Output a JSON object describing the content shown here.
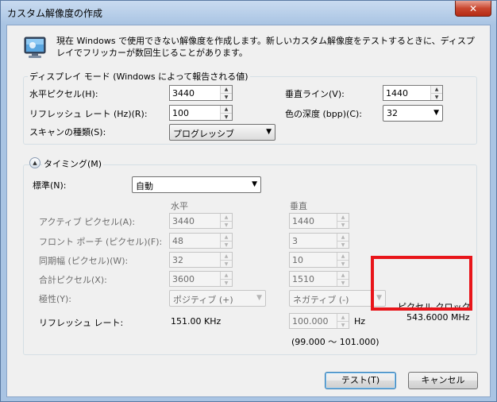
{
  "window": {
    "title": "カスタム解像度の作成",
    "close_label": "✕"
  },
  "description": "現在 Windows で使用できない解像度を作成します。新しいカスタム解像度をテストするときに、ディスプレイでフリッカーが数回生じることがあります。",
  "display_mode": {
    "group_label": "ディスプレイ モード (Windows によって報告される値)",
    "h_pixels_label": "水平ピクセル(H):",
    "h_pixels_value": "3440",
    "v_lines_label": "垂直ライン(V):",
    "v_lines_value": "1440",
    "refresh_label": "リフレッシュ レート (Hz)(R):",
    "refresh_value": "100",
    "color_depth_label": "色の深度 (bpp)(C):",
    "color_depth_value": "32",
    "scan_label": "スキャンの種類(S):",
    "scan_value": "プログレッシブ"
  },
  "timing": {
    "group_label": "タイミング(M)",
    "standard_label": "標準(N):",
    "standard_value": "自動",
    "col_horizontal": "水平",
    "col_vertical": "垂直",
    "rows": [
      {
        "label": "アクティブ ピクセル(A):",
        "h": "3440",
        "v": "1440"
      },
      {
        "label": "フロント ポーチ (ピクセル)(F):",
        "h": "48",
        "v": "3"
      },
      {
        "label": "同期幅 (ピクセル)(W):",
        "h": "32",
        "v": "10"
      },
      {
        "label": "合計ピクセル(X):",
        "h": "3600",
        "v": "1510"
      }
    ],
    "polarity_label": "極性(Y):",
    "polarity_h": "ポジティブ (+)",
    "polarity_v": "ネガティブ (-)",
    "refresh_label": "リフレッシュ レート:",
    "refresh_khz": "151.00 KHz",
    "refresh_hz_value": "100.000",
    "refresh_hz_unit": "Hz",
    "refresh_range": "(99.000 ～ 101.000)",
    "pixel_clock_label": "ピクセル クロック:",
    "pixel_clock_value": "543.6000 MHz"
  },
  "buttons": {
    "test": "テスト(T)",
    "cancel": "キャンセル"
  },
  "colors": {
    "highlight_box": "#e8151a"
  }
}
